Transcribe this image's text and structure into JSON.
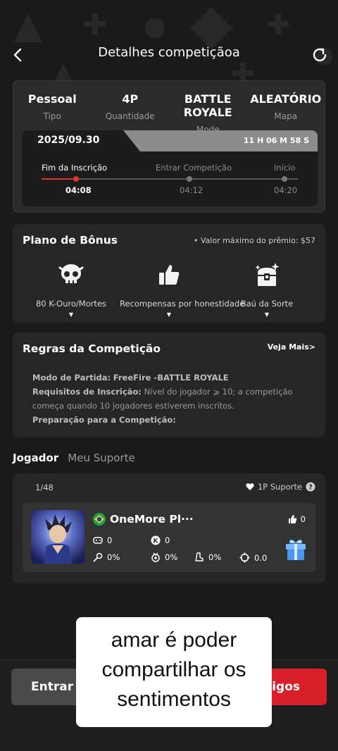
{
  "header": {
    "title": "Detalhes competiçãoa"
  },
  "info": [
    {
      "value": "Pessoal",
      "label": "Tipo"
    },
    {
      "value": "4P",
      "label": "Quantidade"
    },
    {
      "value": "BATTLE ROYALE",
      "label": "Mode"
    },
    {
      "value": "ALEATÓRIO",
      "label": "Mapa"
    }
  ],
  "timeline": {
    "date": "2025/09.30",
    "countdown": "11 H 06 M 58 S",
    "stages": [
      {
        "label": "Fim da Inscrição",
        "time": "04:08",
        "active": true
      },
      {
        "label": "Entrar Competição",
        "time": "04:12",
        "active": false
      },
      {
        "label": "Início",
        "time": "04:20",
        "active": false
      }
    ],
    "progress": 0.12
  },
  "bonus": {
    "title": "Plano de Bônus",
    "max_prize": "• Valor máximo do prêmio:  $57",
    "items": [
      {
        "label": "80 K-Ouro/Mortes",
        "icon": "skull-icon"
      },
      {
        "label": "Recompensas por honestidade",
        "icon": "thumbs-up-icon"
      },
      {
        "label": "Baú da Sorte",
        "icon": "lucky-chest-icon"
      }
    ]
  },
  "rules": {
    "title": "Regras da Competição",
    "see_more": "Veja Mais>",
    "mode_label": "Modo de Partida:",
    "mode_value": "FreeFire -BATTLE ROYALE",
    "req_label": "Requisitos de Inscrição:",
    "req_value": "Nível do jogador ⩾ 10; a competição começa quando 10 jogadores estiverem inscritos.",
    "prep_label": "Preparação para a Competição:"
  },
  "tabs": [
    {
      "label": "Jogador",
      "active": true
    },
    {
      "label": "Meu Suporte",
      "active": false
    }
  ],
  "players": {
    "count": "1/48",
    "support": "1P Suporte",
    "list": [
      {
        "name": "OneMore Pl···",
        "likes": "0",
        "games": "0",
        "kills": "0",
        "stat1": "0%",
        "stat2": "0%",
        "stat3": "0%",
        "stat4": "0.0"
      }
    ]
  },
  "bottom": {
    "enter_label": "Entrar Competição",
    "invite_label": "Convidar Amigos"
  },
  "caption": {
    "line1": "amar é poder",
    "line2": "compartilhar os",
    "line3": "sentimentos"
  },
  "colors": {
    "accent": "#d8202b",
    "background": "#1a1a1a",
    "card": "#262626"
  }
}
